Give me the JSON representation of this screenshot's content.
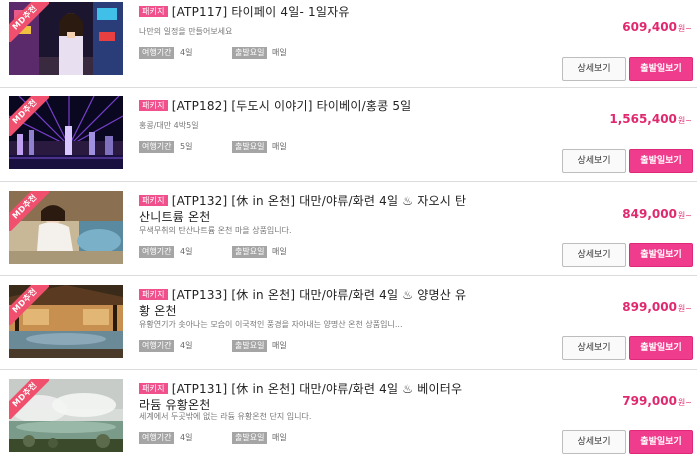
{
  "badge_label": "MD추천",
  "detail_button_label": "상세보기",
  "depart_button_label": "출발일보기",
  "duration_label": "여행기간",
  "departure_label": "출발요일",
  "price_unit": "원~",
  "colors": {
    "price": "#e0286e",
    "depart_button": "#f03c8c",
    "tag": "#f0508c",
    "badge": "#f0506e"
  },
  "products": [
    {
      "tag": "패키지",
      "title_line1": "[ATP117] 타이페이 4일- 1일자유",
      "title_line2": "",
      "description": "나만의 일정을 만들어보세요",
      "duration": "4일",
      "departure_days": "매일",
      "price": "609,400",
      "image": "taipei-street-photo"
    },
    {
      "tag": "패키지",
      "title_line1": "[ATP182] [두도시 이야기] 타이베이/홍콩 5일",
      "title_line2": "",
      "description": "홍콩/대만 4박5일",
      "duration": "5일",
      "departure_days": "매일",
      "price": "1,565,400",
      "image": "hongkong-night-light-show-photo"
    },
    {
      "tag": "패키지",
      "title_line1": "[ATP132] [休 in 온천] 대만/야류/화련 4일 ♨ 자오시 탄",
      "title_line2": "산니트륨 온천",
      "description": "무색무취의 탄산나트륨 온천 마을 상품입니다.",
      "duration": "4일",
      "departure_days": "매일",
      "price": "849,000",
      "image": "hot-spring-bath-photo"
    },
    {
      "tag": "패키지",
      "title_line1": "[ATP133] [休 in 온천] 대만/야류/화련 4일 ♨ 양명산 유",
      "title_line2": "황 온천",
      "description": "유황연기가 솟아나는 모습이 이국적인 풍경을 자아내는 양명산 온천 상품입니...",
      "duration": "4일",
      "departure_days": "매일",
      "price": "899,000",
      "image": "pavilion-hot-spring-photo"
    },
    {
      "tag": "패키지",
      "title_line1": "[ATP131] [休 in 온천] 대만/야류/화련 4일 ♨ 베이터우",
      "title_line2": "라듐 유황온천",
      "description": "세계에서 두곳밖에 없는 라듐 유황온천 단지 입니다.",
      "duration": "4일",
      "departure_days": "매일",
      "price": "799,000",
      "image": "steaming-pond-photo"
    }
  ]
}
